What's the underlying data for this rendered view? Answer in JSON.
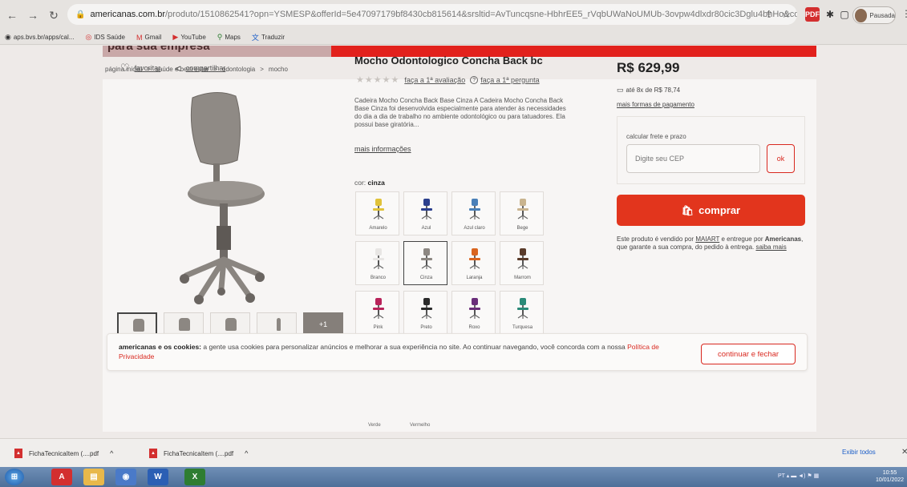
{
  "browser": {
    "url_host": "americanas.com.br",
    "url_path": "/produto/1510862541?opn=YSMESP&offerId=5e47097179bf8430cb815614&srsltid=AvTuncqsne-HbhrEE5_rVqbUWaNoUMUb-3ovpw4dlxdr80cic3Dglu4bhHo&cor=Ci...",
    "profile_label": "Pausada",
    "bookmarks": [
      "aps.bvs.br/apps/cal...",
      "IDS Saúde",
      "Gmail",
      "YouTube",
      "Maps",
      "Traduzir"
    ]
  },
  "banner": {
    "text": "para sua empresa"
  },
  "breadcrumb": [
    "página inicial",
    ">",
    "saúde e bem estar",
    ">",
    "odontologia",
    ">",
    "mocho"
  ],
  "actions": {
    "favorite": "favoritar",
    "share": "compartilhar"
  },
  "thumbs": {
    "more_label": "+1"
  },
  "product": {
    "title": "Mocho Odontologico Concha Back bc",
    "stars": "★★★★★",
    "rate_link": "faça a 1ª avaliação",
    "question_icon": "?",
    "question_link": "faça a 1ª pergunta",
    "description": "Cadeira Mocho Concha Back Base Cinza A Cadeira Mocho Concha Back Base Cinza foi desenvolvida especialmente para atender às necessidades do dia a dia de trabalho no ambiente odontológico ou para tatuadores. Ela possui base giratória...",
    "more_info": "mais informações",
    "color_label": "cor:",
    "color_value": "cinza"
  },
  "colors": [
    {
      "name": "Amarelo",
      "hex": "#e0c23a"
    },
    {
      "name": "Azul",
      "hex": "#2b3f8c"
    },
    {
      "name": "Azul claro",
      "hex": "#4a80b8"
    },
    {
      "name": "Bege",
      "hex": "#c9b48f"
    },
    {
      "name": "Branco",
      "hex": "#e8e6e4"
    },
    {
      "name": "Cinza",
      "hex": "#8c8782"
    },
    {
      "name": "Laranja",
      "hex": "#d9651f"
    },
    {
      "name": "Marrom",
      "hex": "#5a3b2a"
    },
    {
      "name": "Pink",
      "hex": "#b8235a"
    },
    {
      "name": "Preto",
      "hex": "#2a2a2a"
    },
    {
      "name": "Roxo",
      "hex": "#6a2e7a"
    },
    {
      "name": "Turquesa",
      "hex": "#2a8a78"
    }
  ],
  "colors_below": [
    "Verde",
    "Vermelho"
  ],
  "offer": {
    "price": "R$ 629,99",
    "installments": "até 8x de R$ 78,74",
    "more_payment": "mais formas de pagamento",
    "shipping_label": "calcular frete e prazo",
    "cep_placeholder": "Digite seu CEP",
    "ok_label": "ok",
    "buy_label": "comprar",
    "seller_pre": "Este produto é vendido por",
    "seller_name": "MAIART",
    "seller_mid": "e entregue por",
    "seller_store": "Americanas",
    "seller_post": ", que garante a sua compra, do pedido à entrega.",
    "know_more": "saiba mais"
  },
  "cookie": {
    "bold": "americanas e os cookies:",
    "text": " a gente usa cookies para personalizar anúncios e melhorar a sua experiência no site. Ao continuar navegando, você concorda com a nossa ",
    "link": "Política de Privacidade",
    "button": "continuar e fechar"
  },
  "downloads": {
    "items": [
      "FichaTecnicaItem (....pdf",
      "FichaTecnicaItem (....pdf"
    ],
    "show_all": "Exibir todos"
  },
  "taskbar": {
    "lang": "PT",
    "time": "10:55",
    "date": "10/01/2022"
  }
}
